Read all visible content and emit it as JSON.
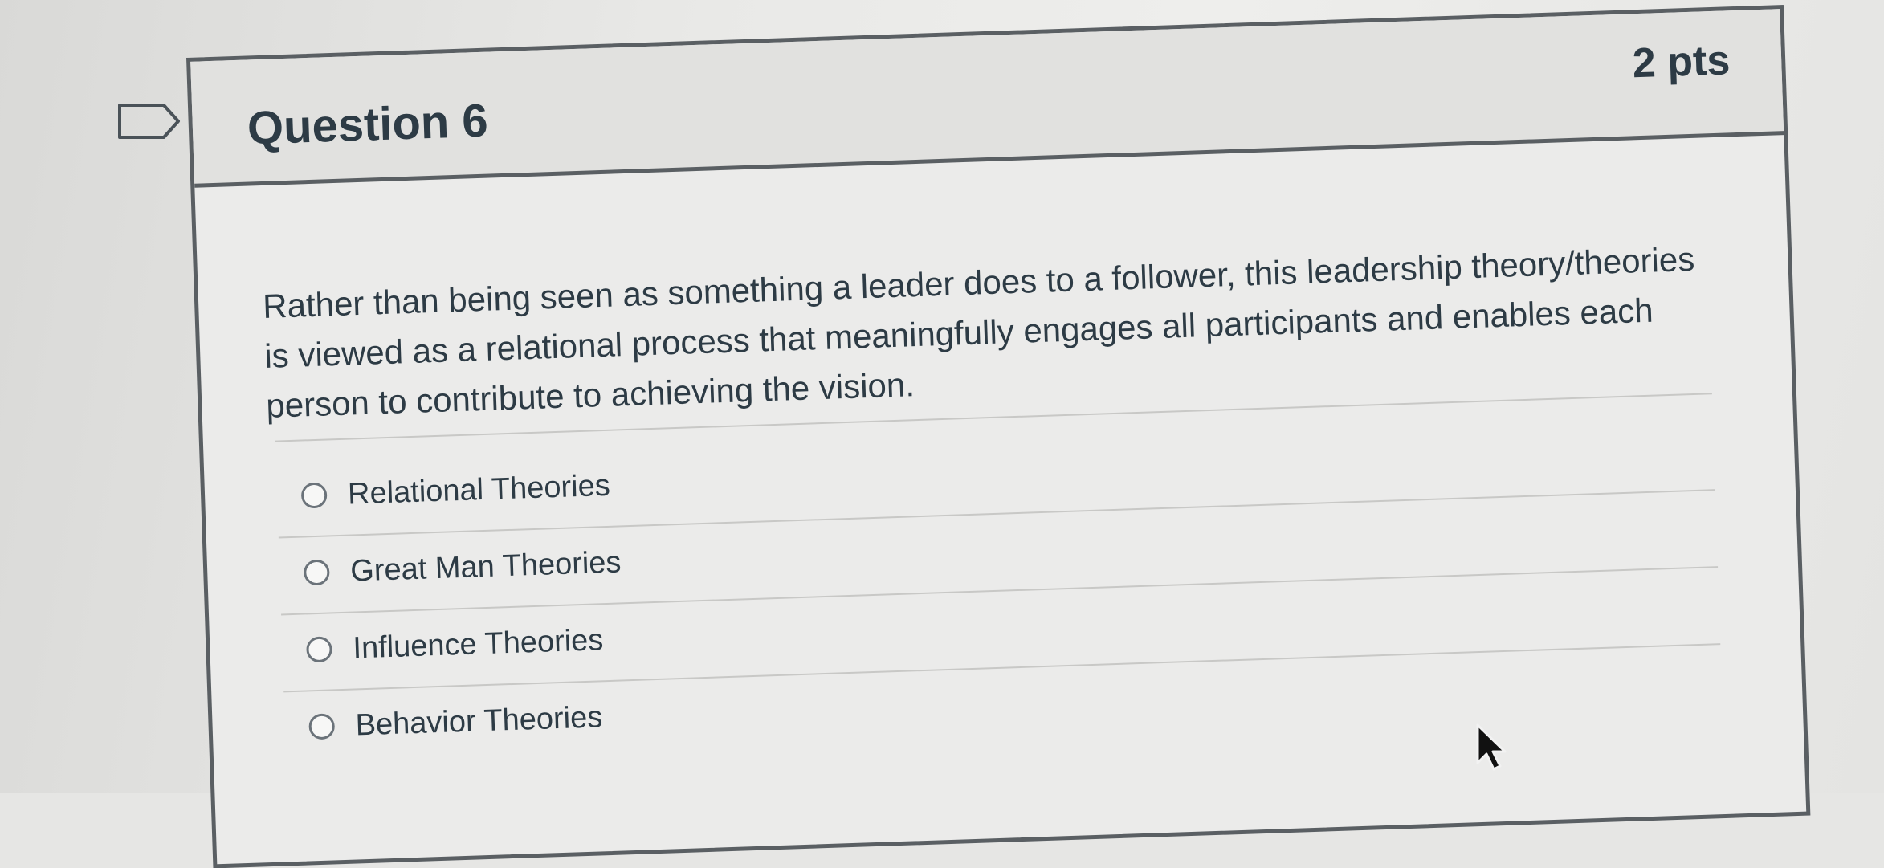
{
  "question": {
    "title": "Question 6",
    "points": "2 pts",
    "text": "Rather than being seen as something a leader does to a follower, this leadership theory/theories is viewed as a relational process that meaningfully engages all participants and enables each person to contribute to achieving the vision.",
    "answers": [
      {
        "label": "Relational Theories",
        "selected": false
      },
      {
        "label": "Great Man Theories",
        "selected": false
      },
      {
        "label": "Influence Theories",
        "selected": false
      },
      {
        "label": "Behavior Theories",
        "selected": false
      }
    ]
  },
  "icons": {
    "flag": "bookmark-flag-icon",
    "cursor": "mouse-pointer-icon"
  }
}
